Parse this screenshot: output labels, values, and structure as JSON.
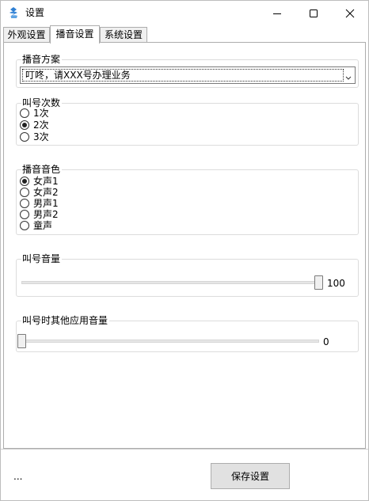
{
  "window": {
    "title": "设置",
    "icon": "app-logo-icon",
    "controls": {
      "minimize": "minimize-icon",
      "maximize": "maximize-icon",
      "close": "close-icon"
    }
  },
  "tabs": [
    {
      "label": "外观设置",
      "active": false
    },
    {
      "label": "播音设置",
      "active": true
    },
    {
      "label": "系统设置",
      "active": false
    }
  ],
  "broadcast_scheme": {
    "label": "播音方案",
    "selected": "叮咚，请XXX号办理业务"
  },
  "call_count": {
    "label": "叫号次数",
    "options": [
      "1次",
      "2次",
      "3次"
    ],
    "selected_index": 1
  },
  "voice": {
    "label": "播音音色",
    "options": [
      "女声1",
      "女声2",
      "男声1",
      "男声2",
      "童声"
    ],
    "selected_index": 0
  },
  "call_volume": {
    "label": "叫号音量",
    "value": "100",
    "level": 100
  },
  "other_volume": {
    "label": "叫号时其他应用音量",
    "value": "0",
    "level": 0
  },
  "footer": {
    "status": "...",
    "save_label": "保存设置"
  }
}
